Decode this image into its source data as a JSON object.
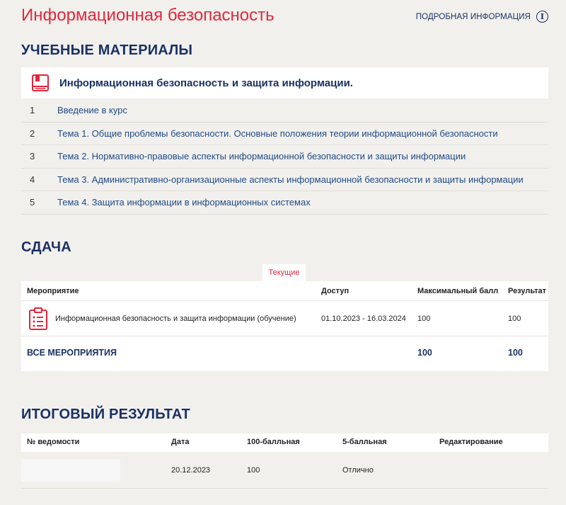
{
  "header": {
    "title": "Информационная безопасность",
    "more_info": "ПОДРОБНАЯ ИНФОРМАЦИЯ",
    "info_icon": "i"
  },
  "materials": {
    "section_title": "УЧЕБНЫЕ МАТЕРИАЛЫ",
    "course_title": "Информационная безопасность и защита информации.",
    "topics": [
      {
        "num": "1",
        "label": "Введение в курс"
      },
      {
        "num": "2",
        "label": "Тема 1. Общие проблемы безопасности. Основные положения теории информационной безопасности"
      },
      {
        "num": "3",
        "label": "Тема 2. Нормативно-правовые аспекты информационной безопасности и защиты информации"
      },
      {
        "num": "4",
        "label": "Тема 3. Административно-организационные аспекты информационной безопасности и защиты информации"
      },
      {
        "num": "5",
        "label": "Тема 4. Защита информации в информационных системах"
      }
    ]
  },
  "submission": {
    "section_title": "СДАЧА",
    "tab_current": "Текущие",
    "columns": {
      "event": "Мероприятие",
      "access": "Доступ",
      "max_score": "Максимальный балл",
      "result": "Результат"
    },
    "rows": [
      {
        "event": "Информационная безопасность и защита информации (обучение)",
        "access": "01.10.2023 - 16.03.2024",
        "max_score": "100",
        "result": "100"
      }
    ],
    "total": {
      "label": "ВСЕ МЕРОПРИЯТИЯ",
      "max_score": "100",
      "result": "100"
    }
  },
  "final": {
    "section_title": "ИТОГОВЫЙ РЕЗУЛЬТАТ",
    "columns": {
      "sheet_no": "№ ведомости",
      "date": "Дата",
      "score100": "100-балльная",
      "score5": "5-балльная",
      "editing": "Редактирование"
    },
    "rows": [
      {
        "sheet_no": "",
        "date": "20.12.2023",
        "score100": "100",
        "score5": "Отлично",
        "editing": ""
      }
    ]
  },
  "colors": {
    "brand_red": "#e3263c",
    "navy": "#1a3163",
    "link": "#1f4a86",
    "background": "#f2f0ed"
  },
  "icons": {
    "course": "book-icon",
    "event": "clipboard-icon",
    "info": "info-icon"
  }
}
